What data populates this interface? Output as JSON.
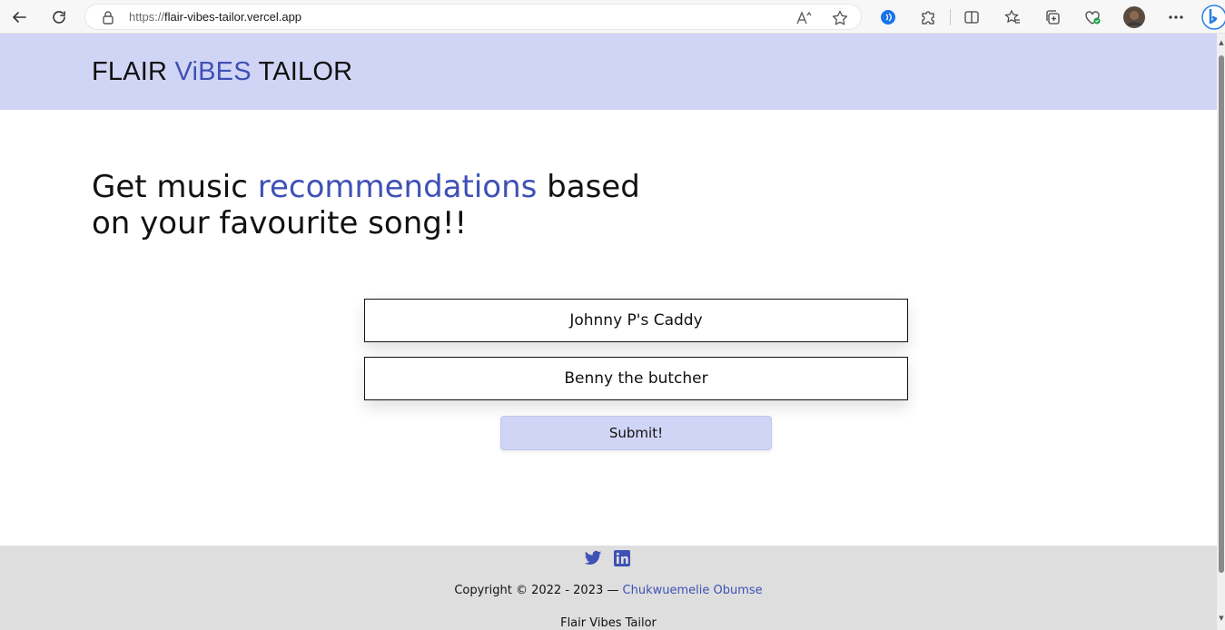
{
  "browser": {
    "url_protocol": "https://",
    "url_host": "flair-vibes-tailor.vercel.app"
  },
  "header": {
    "logo_part1": "FLAIR ",
    "logo_accent": "ViBES",
    "logo_part2": " TAILOR"
  },
  "hero": {
    "text_before": "Get music ",
    "text_accent": "recommendations",
    "text_after": " based on your favourite song!!"
  },
  "form": {
    "song_value": "Johnny P's Caddy",
    "artist_value": "Benny the butcher",
    "submit_label": "Submit!"
  },
  "footer": {
    "copyright_text": "Copyright © 2022 - 2023 — ",
    "author_link": "Chukwuemelie Obumse",
    "brand": "Flair Vibes Tailor"
  },
  "colors": {
    "accent": "#3f51b5",
    "header_bg": "#d1d5f5",
    "footer_bg": "#dedede"
  },
  "icons": [
    "back-icon",
    "refresh-icon",
    "lock-icon",
    "read-aloud-icon",
    "favorite-star-icon",
    "extension-icon",
    "puzzle-icon",
    "split-screen-icon",
    "favorites-icon",
    "collections-icon",
    "performance-icon",
    "profile-avatar",
    "more-icon",
    "bing-icon",
    "twitter-icon",
    "linkedin-icon"
  ]
}
